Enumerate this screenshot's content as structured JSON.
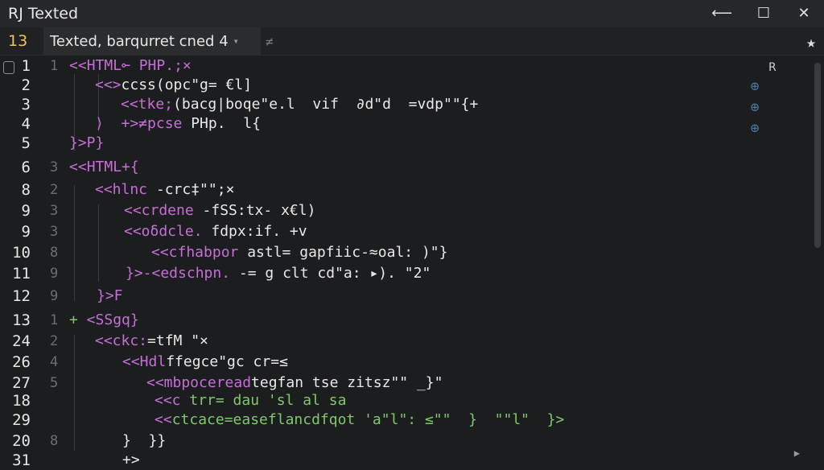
{
  "window": {
    "title": "RJ Texted",
    "controls": {
      "minimize": "⟵",
      "maximize": "☐",
      "close": "✕"
    }
  },
  "tabbar": {
    "line_indicator": "13",
    "tab_label": "Texted, barqurret cned 4",
    "tab_caret": "▾",
    "tab_close": "≠",
    "star": "★"
  },
  "minimap": {
    "label": "R",
    "icons": [
      "⊕",
      "⊕",
      "⊕"
    ]
  },
  "lines": [
    {
      "num": "1",
      "fold": "1",
      "code": [
        {
          "t": "<<",
          "c": "purple"
        },
        {
          "t": "HTML",
          "c": "purple"
        },
        {
          "t": "⟜ PHP.;×",
          "c": "purple"
        }
      ]
    },
    {
      "num": "2",
      "fold": "",
      "code": [
        {
          "t": "<<>",
          "c": "purple"
        },
        {
          "t": "ccss(opc\"g= €l]",
          "c": "white"
        }
      ]
    },
    {
      "num": "3",
      "fold": "",
      "code": [
        {
          "t": "<<tke;",
          "c": "purple"
        },
        {
          "t": "(bacg|",
          "c": "white"
        },
        {
          "t": "boqe\"e.l  vif  ∂d\"d  =vdp\"\"{+",
          "c": "white"
        }
      ]
    },
    {
      "num": "4",
      "fold": "",
      "code": [
        {
          "t": "⟩  +>≠pcse",
          "c": "purple"
        },
        {
          "t": " PHp.  l{",
          "c": "white"
        }
      ]
    },
    {
      "num": "5",
      "fold": "",
      "code": [
        {
          "t": "}>P}",
          "c": "purple"
        },
        {
          "t": "",
          "c": "white"
        }
      ]
    },
    {
      "num": "6",
      "fold": "3",
      "code": [
        {
          "t": "<<",
          "c": "purple"
        },
        {
          "t": "HTML+{",
          "c": "purple"
        }
      ]
    },
    {
      "num": "8",
      "fold": "2",
      "code": [
        {
          "t": "<<hlnc",
          "c": "purple"
        },
        {
          "t": " -crc‡\"\";×",
          "c": "white"
        }
      ]
    },
    {
      "num": "9",
      "fold": "3",
      "code": [
        {
          "t": "<<crdene",
          "c": "purple"
        },
        {
          "t": " -fSS:tx- x€l)",
          "c": "white"
        }
      ]
    },
    {
      "num": "9",
      "fold": "3",
      "code": [
        {
          "t": "<<oδdcle.",
          "c": "purple"
        },
        {
          "t": " fdpx:if. +v",
          "c": "white"
        }
      ]
    },
    {
      "num": "10",
      "fold": "8",
      "code": [
        {
          "t": "<<cfhabpor",
          "c": "purple"
        },
        {
          "t": " astl= gapfiic-≈oal: )\"}",
          "c": "white"
        }
      ]
    },
    {
      "num": "11",
      "fold": "9",
      "code": [
        {
          "t": "}>-<edschpn.",
          "c": "purple"
        },
        {
          "t": " -= g clt cd\"a: ▸). \"2\"",
          "c": "white"
        }
      ]
    },
    {
      "num": "12",
      "fold": "9",
      "code": [
        {
          "t": "}>F",
          "c": "purple"
        }
      ]
    },
    {
      "num": "13",
      "fold": "1",
      "code": [
        {
          "t": "+",
          "c": "green"
        },
        {
          "t": " <SSgq}",
          "c": "purple"
        }
      ]
    },
    {
      "num": "24",
      "fold": "2",
      "code": [
        {
          "t": "<<ckc:",
          "c": "purple"
        },
        {
          "t": "=tfM \"×",
          "c": "white"
        }
      ]
    },
    {
      "num": "26",
      "fold": "4",
      "code": [
        {
          "t": "<<Hdl",
          "c": "purple"
        },
        {
          "t": "ffegce\"gc cr=≤",
          "c": "white"
        }
      ]
    },
    {
      "num": "27",
      "fold": "5",
      "code": [
        {
          "t": "<<mbpoceread",
          "c": "purple"
        },
        {
          "t": "tegfan tse zitsz\"\" _}\"",
          "c": "white"
        }
      ]
    },
    {
      "num": "18",
      "fold": "",
      "code": [
        {
          "t": "<<c",
          "c": "purple"
        },
        {
          "t": " trr= dau 'sl al sa",
          "c": "green"
        }
      ]
    },
    {
      "num": "29",
      "fold": "",
      "code": [
        {
          "t": "<<",
          "c": "purple"
        },
        {
          "t": "ctcace=easeflancdfqot 'a\"l\": ≤\"\"  }  \"\"l\"  }>",
          "c": "green"
        }
      ]
    },
    {
      "num": "20",
      "fold": "8",
      "code": [
        {
          "t": "}  }}",
          "c": "white"
        }
      ]
    },
    {
      "num": "31",
      "fold": "",
      "code": [
        {
          "t": "+>",
          "c": "white"
        }
      ]
    }
  ]
}
